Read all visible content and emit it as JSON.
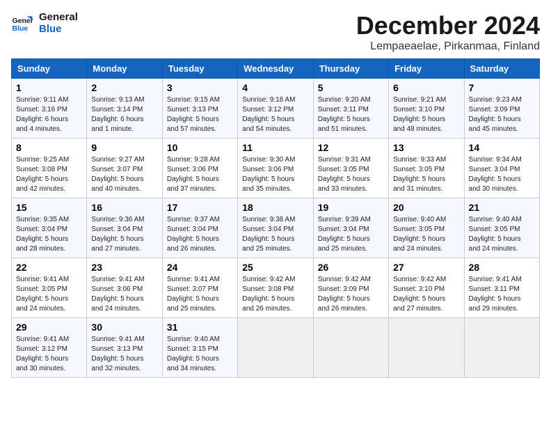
{
  "logo": {
    "line1": "General",
    "line2": "Blue"
  },
  "title": "December 2024",
  "location": "Lempaeaelae, Pirkanmaa, Finland",
  "days_of_week": [
    "Sunday",
    "Monday",
    "Tuesday",
    "Wednesday",
    "Thursday",
    "Friday",
    "Saturday"
  ],
  "weeks": [
    [
      {
        "day": "1",
        "info": "Sunrise: 9:11 AM\nSunset: 3:16 PM\nDaylight: 6 hours\nand 4 minutes."
      },
      {
        "day": "2",
        "info": "Sunrise: 9:13 AM\nSunset: 3:14 PM\nDaylight: 6 hours\nand 1 minute."
      },
      {
        "day": "3",
        "info": "Sunrise: 9:15 AM\nSunset: 3:13 PM\nDaylight: 5 hours\nand 57 minutes."
      },
      {
        "day": "4",
        "info": "Sunrise: 9:18 AM\nSunset: 3:12 PM\nDaylight: 5 hours\nand 54 minutes."
      },
      {
        "day": "5",
        "info": "Sunrise: 9:20 AM\nSunset: 3:11 PM\nDaylight: 5 hours\nand 51 minutes."
      },
      {
        "day": "6",
        "info": "Sunrise: 9:21 AM\nSunset: 3:10 PM\nDaylight: 5 hours\nand 48 minutes."
      },
      {
        "day": "7",
        "info": "Sunrise: 9:23 AM\nSunset: 3:09 PM\nDaylight: 5 hours\nand 45 minutes."
      }
    ],
    [
      {
        "day": "8",
        "info": "Sunrise: 9:25 AM\nSunset: 3:08 PM\nDaylight: 5 hours\nand 42 minutes."
      },
      {
        "day": "9",
        "info": "Sunrise: 9:27 AM\nSunset: 3:07 PM\nDaylight: 5 hours\nand 40 minutes."
      },
      {
        "day": "10",
        "info": "Sunrise: 9:28 AM\nSunset: 3:06 PM\nDaylight: 5 hours\nand 37 minutes."
      },
      {
        "day": "11",
        "info": "Sunrise: 9:30 AM\nSunset: 3:06 PM\nDaylight: 5 hours\nand 35 minutes."
      },
      {
        "day": "12",
        "info": "Sunrise: 9:31 AM\nSunset: 3:05 PM\nDaylight: 5 hours\nand 33 minutes."
      },
      {
        "day": "13",
        "info": "Sunrise: 9:33 AM\nSunset: 3:05 PM\nDaylight: 5 hours\nand 31 minutes."
      },
      {
        "day": "14",
        "info": "Sunrise: 9:34 AM\nSunset: 3:04 PM\nDaylight: 5 hours\nand 30 minutes."
      }
    ],
    [
      {
        "day": "15",
        "info": "Sunrise: 9:35 AM\nSunset: 3:04 PM\nDaylight: 5 hours\nand 28 minutes."
      },
      {
        "day": "16",
        "info": "Sunrise: 9:36 AM\nSunset: 3:04 PM\nDaylight: 5 hours\nand 27 minutes."
      },
      {
        "day": "17",
        "info": "Sunrise: 9:37 AM\nSunset: 3:04 PM\nDaylight: 5 hours\nand 26 minutes."
      },
      {
        "day": "18",
        "info": "Sunrise: 9:38 AM\nSunset: 3:04 PM\nDaylight: 5 hours\nand 25 minutes."
      },
      {
        "day": "19",
        "info": "Sunrise: 9:39 AM\nSunset: 3:04 PM\nDaylight: 5 hours\nand 25 minutes."
      },
      {
        "day": "20",
        "info": "Sunrise: 9:40 AM\nSunset: 3:05 PM\nDaylight: 5 hours\nand 24 minutes."
      },
      {
        "day": "21",
        "info": "Sunrise: 9:40 AM\nSunset: 3:05 PM\nDaylight: 5 hours\nand 24 minutes."
      }
    ],
    [
      {
        "day": "22",
        "info": "Sunrise: 9:41 AM\nSunset: 3:05 PM\nDaylight: 5 hours\nand 24 minutes."
      },
      {
        "day": "23",
        "info": "Sunrise: 9:41 AM\nSunset: 3:06 PM\nDaylight: 5 hours\nand 24 minutes."
      },
      {
        "day": "24",
        "info": "Sunrise: 9:41 AM\nSunset: 3:07 PM\nDaylight: 5 hours\nand 25 minutes."
      },
      {
        "day": "25",
        "info": "Sunrise: 9:42 AM\nSunset: 3:08 PM\nDaylight: 5 hours\nand 26 minutes."
      },
      {
        "day": "26",
        "info": "Sunrise: 9:42 AM\nSunset: 3:09 PM\nDaylight: 5 hours\nand 26 minutes."
      },
      {
        "day": "27",
        "info": "Sunrise: 9:42 AM\nSunset: 3:10 PM\nDaylight: 5 hours\nand 27 minutes."
      },
      {
        "day": "28",
        "info": "Sunrise: 9:41 AM\nSunset: 3:11 PM\nDaylight: 5 hours\nand 29 minutes."
      }
    ],
    [
      {
        "day": "29",
        "info": "Sunrise: 9:41 AM\nSunset: 3:12 PM\nDaylight: 5 hours\nand 30 minutes."
      },
      {
        "day": "30",
        "info": "Sunrise: 9:41 AM\nSunset: 3:13 PM\nDaylight: 5 hours\nand 32 minutes."
      },
      {
        "day": "31",
        "info": "Sunrise: 9:40 AM\nSunset: 3:15 PM\nDaylight: 5 hours\nand 34 minutes."
      },
      {
        "day": "",
        "info": ""
      },
      {
        "day": "",
        "info": ""
      },
      {
        "day": "",
        "info": ""
      },
      {
        "day": "",
        "info": ""
      }
    ]
  ]
}
